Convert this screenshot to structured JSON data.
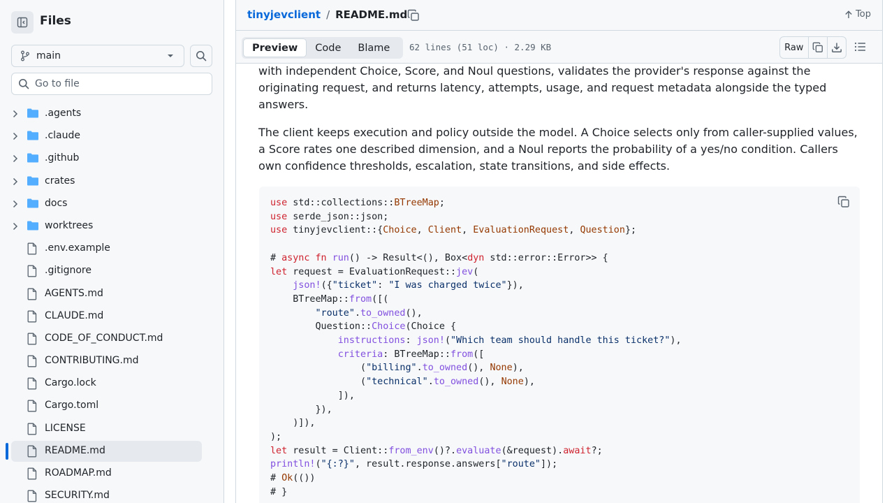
{
  "sidebar": {
    "title": "Files",
    "branch": "main",
    "goto_placeholder": "Go to file",
    "items": [
      {
        "name": ".agents",
        "type": "folder"
      },
      {
        "name": ".claude",
        "type": "folder"
      },
      {
        "name": ".github",
        "type": "folder"
      },
      {
        "name": "crates",
        "type": "folder"
      },
      {
        "name": "docs",
        "type": "folder"
      },
      {
        "name": "worktrees",
        "type": "folder"
      },
      {
        "name": ".env.example",
        "type": "file"
      },
      {
        "name": ".gitignore",
        "type": "file"
      },
      {
        "name": "AGENTS.md",
        "type": "file"
      },
      {
        "name": "CLAUDE.md",
        "type": "file"
      },
      {
        "name": "CODE_OF_CONDUCT.md",
        "type": "file"
      },
      {
        "name": "CONTRIBUTING.md",
        "type": "file"
      },
      {
        "name": "Cargo.lock",
        "type": "file"
      },
      {
        "name": "Cargo.toml",
        "type": "file"
      },
      {
        "name": "LICENSE",
        "type": "file"
      },
      {
        "name": "README.md",
        "type": "file",
        "selected": true
      },
      {
        "name": "ROADMAP.md",
        "type": "file"
      },
      {
        "name": "SECURITY.md",
        "type": "file"
      }
    ]
  },
  "header": {
    "repo": "tinyjevclient",
    "separator": "/",
    "file": "README.md",
    "top_label": "Top"
  },
  "toolbar": {
    "tabs": [
      "Preview",
      "Code",
      "Blame"
    ],
    "active_tab": "Preview",
    "file_info": "62 lines (51 loc) · 2.29 KB",
    "raw_label": "Raw"
  },
  "content": {
    "paragraph1": "with independent Choice, Score, and Noul questions, validates the provider's response against the originating request, and returns latency, attempts, usage, and request metadata alongside the typed answers.",
    "paragraph2": "The client keeps execution and policy outside the model. A Choice selects only from caller-supplied values, a Score rates one described dimension, and a Noul reports the probability of a yes/no condition. Callers own confidence thresholds, escalation, state transitions, and side effects.",
    "code_lines": [
      "use std::collections::BTreeMap;",
      "use serde_json::json;",
      "use tinyjevclient::{Choice, Client, EvaluationRequest, Question};",
      "",
      "# async fn run() -> Result<(), Box<dyn std::error::Error>> {",
      "let request = EvaluationRequest::jev(",
      "    json!({\"ticket\": \"I was charged twice\"}),",
      "    BTreeMap::from([(",
      "        \"route\".to_owned(),",
      "        Question::Choice(Choice {",
      "            instructions: json!(\"Which team should handle this ticket?\"),",
      "            criteria: BTreeMap::from([",
      "                (\"billing\".to_owned(), None),",
      "                (\"technical\".to_owned(), None),",
      "            ]),",
      "        }),",
      "    )]),",
      ");",
      "let result = Client::from_env()?.evaluate(&request).await?;",
      "println!(\"{:?}\", result.response.answers[\"route\"]);",
      "# Ok(())",
      "# }"
    ]
  },
  "colors": {
    "accent": "#0969da",
    "folder": "#54aeff",
    "keyword": "#cf222e",
    "type": "#953800",
    "function": "#8250df",
    "string": "#0a3069"
  }
}
